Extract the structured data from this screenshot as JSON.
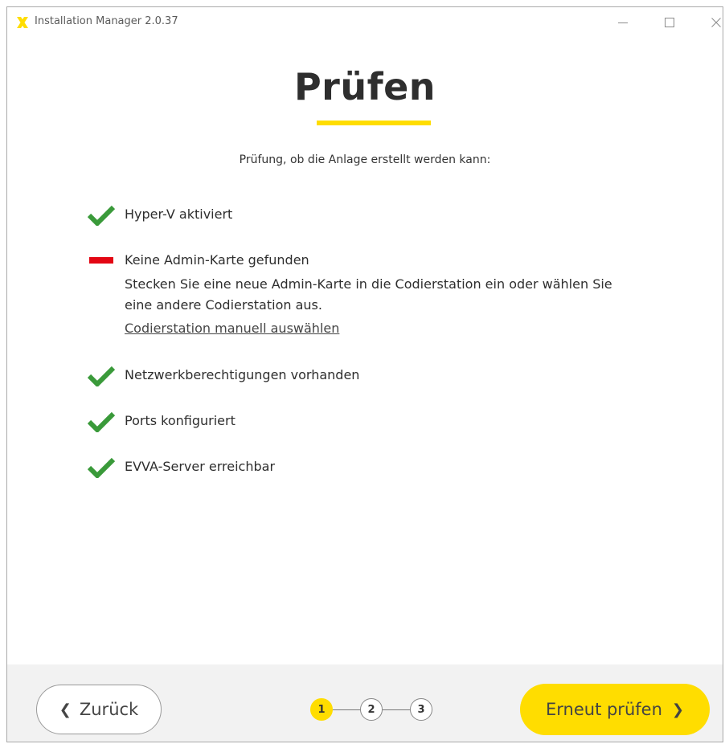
{
  "window": {
    "title": "Installation Manager 2.0.37",
    "controls": {
      "minimize": "—",
      "maximize": "☐",
      "close": "✕"
    }
  },
  "page": {
    "heading": "Prüfen",
    "intro": "Prüfung, ob die Anlage erstellt werden kann:"
  },
  "checks": [
    {
      "status": "ok",
      "label": "Hyper-V aktiviert"
    },
    {
      "status": "error",
      "label": "Keine Admin-Karte gefunden",
      "detail": "Stecken Sie eine neue Admin-Karte in die Codierstation ein oder wählen Sie eine andere Codierstation aus.",
      "link": "Codierstation manuell auswählen"
    },
    {
      "status": "ok",
      "label": "Netzwerkberechtigungen vorhanden"
    },
    {
      "status": "ok",
      "label": "Ports konfiguriert"
    },
    {
      "status": "ok",
      "label": "EVVA-Server erreichbar"
    }
  ],
  "footer": {
    "back_label": "Zurück",
    "back_icon": "chevron-left-icon",
    "retry_label": "Erneut prüfen",
    "retry_icon": "chevron-right-icon",
    "steps": [
      "1",
      "2",
      "3"
    ],
    "active_step": 1
  },
  "colors": {
    "accent": "#ffdd00",
    "ok": "#3a9a3a",
    "error": "#e30613",
    "footer_bg": "#f2f2f2"
  }
}
